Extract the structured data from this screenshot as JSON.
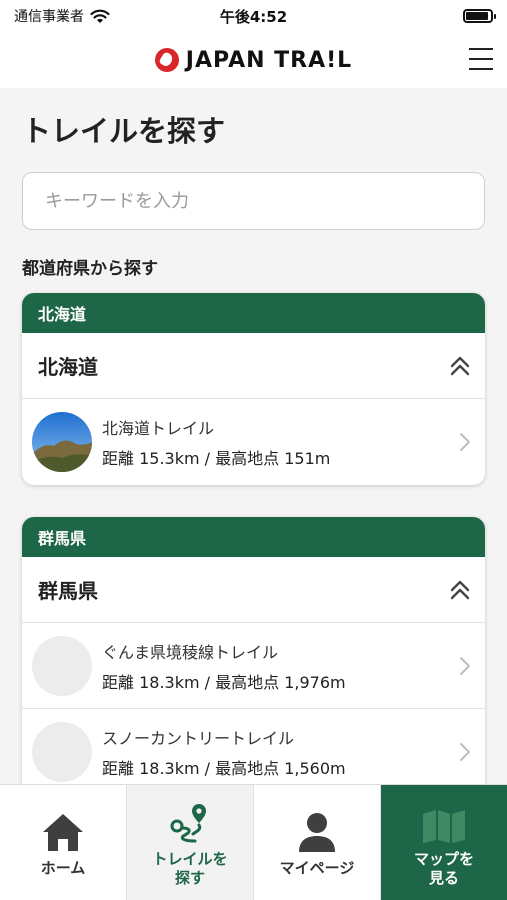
{
  "status_bar": {
    "carrier": "通信事業者",
    "time": "午後4:52",
    "battery_level": 0.9,
    "icons": [
      "wifi-icon",
      "battery-icon"
    ]
  },
  "header": {
    "logo_text": "JAPAN TRA!L",
    "icons": [
      "logo-mark-icon",
      "hamburger-menu-icon"
    ]
  },
  "page": {
    "title": "トレイルを探す",
    "search": {
      "placeholder": "キーワードを入力",
      "value": ""
    },
    "section_label": "都道府県から探す"
  },
  "prefectures": [
    {
      "tag": "北海道",
      "name": "北海道",
      "trails": [
        {
          "name": "北海道トレイル",
          "meta": "距離 15.3km / 最高地点 151m",
          "has_photo": true
        }
      ]
    },
    {
      "tag": "群馬県",
      "name": "群馬県",
      "trails": [
        {
          "name": "ぐんま県境稜線トレイル",
          "meta": "距離 18.3km / 最高地点 1,976m",
          "has_photo": false
        },
        {
          "name": "スノーカントリートレイル",
          "meta": "距離 18.3km / 最高地点 1,560m",
          "has_photo": false
        }
      ]
    }
  ],
  "tab_bar": {
    "tabs": [
      {
        "label": "ホーム",
        "icon": "home-icon"
      },
      {
        "label": "トレイルを\n探す",
        "icon": "route-icon",
        "active": true
      },
      {
        "label": "マイページ",
        "icon": "person-icon"
      },
      {
        "label": "マップを\n見る",
        "icon": "map-icon"
      }
    ]
  },
  "colors": {
    "brand_green": "#1d6647",
    "logo_red": "#d9262b",
    "background": "#f4f4f4"
  }
}
